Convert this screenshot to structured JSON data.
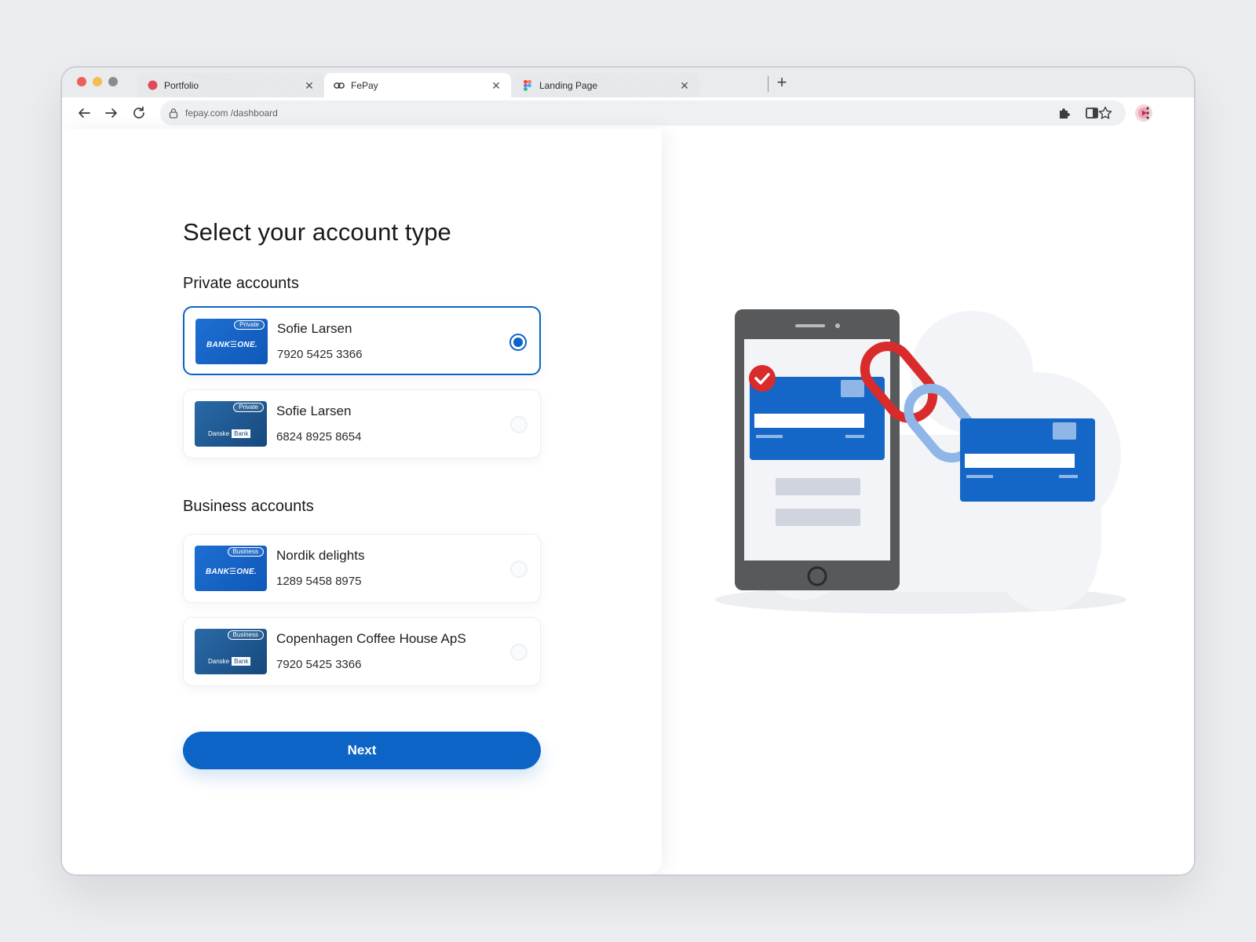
{
  "browser": {
    "tabs": [
      {
        "title": "Portfolio",
        "favicon": "portfolio-dot-icon",
        "active": false
      },
      {
        "title": "FePay",
        "favicon": "link-icon",
        "active": true
      },
      {
        "title": "Landing Page",
        "favicon": "figma-icon",
        "active": false
      }
    ],
    "close_glyph": "✕",
    "new_tab_glyph": "+",
    "url": "fepay.com /dashboard",
    "icons": [
      "back-arrow-icon",
      "forward-arrow-icon",
      "reload-icon",
      "lock-icon",
      "bookmark-star-icon",
      "extensions-puzzle-icon",
      "side-panel-icon",
      "profile-avatar-icon",
      "more-vertical-icon"
    ]
  },
  "page": {
    "title": "Select your account type",
    "private_section": {
      "title": "Private accounts",
      "accounts": [
        {
          "name": "Sofie Larsen",
          "number": "7920 5425 3366",
          "type_label": "Private",
          "bank": "BANKONE",
          "bank_logo_text": "BANK☰ONE.",
          "selected": true
        },
        {
          "name": "Sofie Larsen",
          "number": "6824 8925 8654",
          "type_label": "Private",
          "bank": "Danske Bank",
          "bank_logo_text_1": "Danske",
          "bank_logo_text_2": "Bank",
          "selected": false
        }
      ]
    },
    "business_section": {
      "title": "Business accounts",
      "accounts": [
        {
          "name": "Nordik delights",
          "number": "1289 5458 8975",
          "type_label": "Business",
          "bank": "BANKONE",
          "bank_logo_text": "BANK☰ONE.",
          "selected": false
        },
        {
          "name": "Copenhagen Coffee House ApS",
          "number": "7920 5425 3366",
          "type_label": "Business",
          "bank": "Danske Bank",
          "bank_logo_text_1": "Danske",
          "bank_logo_text_2": "Bank",
          "selected": false
        }
      ]
    },
    "next_button": "Next"
  },
  "colors": {
    "primary": "#0c64c6",
    "chain_red": "#d92b2b",
    "chain_light_blue": "#8fb6e6",
    "phone_gray": "#58595b",
    "cloud": "#f3f4f8"
  }
}
